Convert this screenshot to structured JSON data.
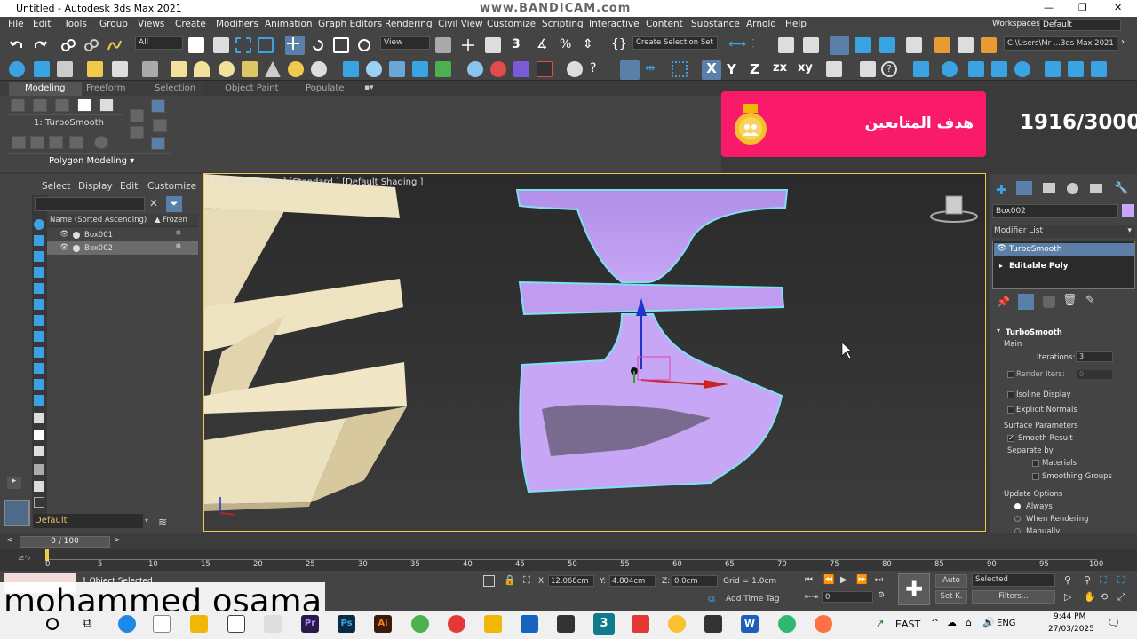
{
  "title_bar": {
    "title": "Untitled - Autodesk 3ds Max 2021",
    "watermark": "www.BANDICAM.com"
  },
  "menu": [
    "File",
    "Edit",
    "Tools",
    "Group",
    "Views",
    "Create",
    "Modifiers",
    "Animation",
    "Graph Editors",
    "Rendering",
    "Civil View",
    "Customize",
    "Scripting",
    "Interactive",
    "Content",
    "Substance",
    "Arnold",
    "Help"
  ],
  "workspaces": {
    "label": "Workspaces:",
    "value": "Default"
  },
  "toolbar": {
    "selection_filter": "All",
    "ref_coord": "View",
    "named_selection": "Create Selection Set",
    "project_path": "C:\\Users\\Mr ...3ds Max 2021"
  },
  "ribbon": {
    "tabs": [
      "Modeling",
      "Freeform",
      "Selection",
      "Object Paint",
      "Populate"
    ],
    "modifier_label": "1: TurboSmooth",
    "panel_label": "Polygon Modeling"
  },
  "banner": {
    "text": "هدف المتابعين",
    "counter": "1916/3000"
  },
  "scene_explorer": {
    "tabs": [
      "Select",
      "Display",
      "Edit",
      "Customize"
    ],
    "column_name": "Name (Sorted Ascending)",
    "column_frozen": "Frozen",
    "objects": [
      {
        "name": "Box001"
      },
      {
        "name": "Box002"
      }
    ],
    "layer": "Default"
  },
  "viewport": {
    "label": "[+] [Perspective ] [Standard ] [Default Shading ]"
  },
  "command_panel": {
    "object_name": "Box002",
    "object_color": "#c9a5ff",
    "modifier_list_label": "Modifier List",
    "stack": [
      "TurboSmooth",
      "Editable Poly"
    ],
    "rollout": {
      "title": "TurboSmooth",
      "main": "Main",
      "iterations_label": "Iterations:",
      "iterations_value": "3",
      "render_iters_label": "Render Iters:",
      "render_iters_value": "0",
      "isoline": "Isoline Display",
      "explicit": "Explicit Normals",
      "surface_params": "Surface Parameters",
      "smooth_result": "Smooth Result",
      "separate_by": "Separate by:",
      "materials": "Materials",
      "smoothing_groups": "Smoothing Groups",
      "update_options": "Update Options",
      "always": "Always",
      "when_rendering": "When Rendering",
      "manually": "Manually"
    }
  },
  "time": {
    "slider": "0 / 100",
    "ticks": [
      "0",
      "5",
      "10",
      "15",
      "20",
      "25",
      "30",
      "35",
      "40",
      "45",
      "50",
      "55",
      "60",
      "65",
      "70",
      "75",
      "80",
      "85",
      "90",
      "95",
      "100"
    ]
  },
  "status": {
    "selected": "1 Object Selected",
    "x_label": "X:",
    "x": "12.068cm",
    "y_label": "Y:",
    "y": "4.804cm",
    "z_label": "Z:",
    "z": "0.0cm",
    "grid": "Grid = 1.0cm",
    "add_time_tag": "Add Time Tag",
    "auto": "Auto",
    "set_key": "Set K.",
    "key_filter": "Selected",
    "filters": "Filters...",
    "frame": "0"
  },
  "overlay": {
    "name": "mohammed osama"
  },
  "taskbar": {
    "weather": "EAST",
    "lang": "ENG",
    "time": "9:44 PM",
    "date": "27/03/2025"
  }
}
